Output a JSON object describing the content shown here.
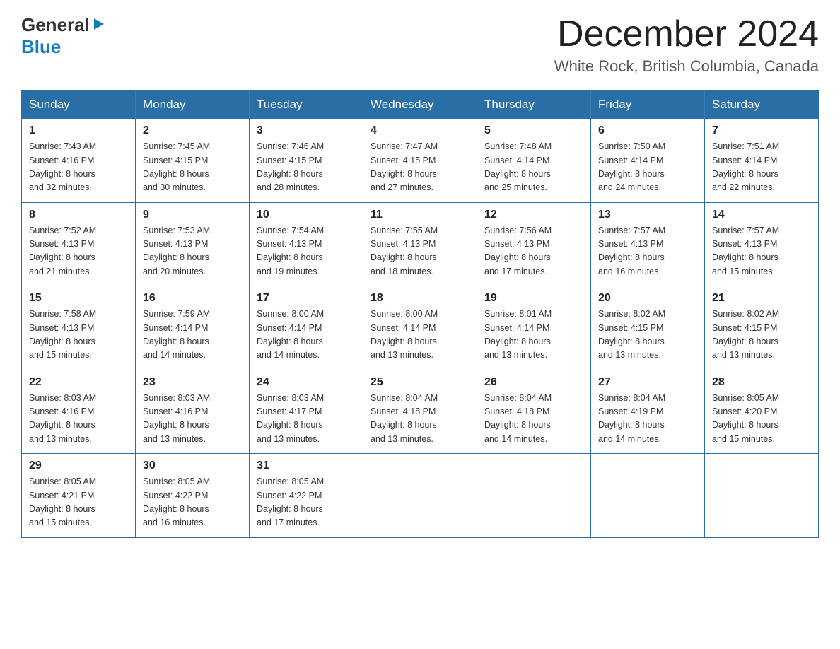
{
  "header": {
    "logo_general": "General",
    "logo_arrow": "▶",
    "logo_blue": "Blue",
    "month_title": "December 2024",
    "location": "White Rock, British Columbia, Canada"
  },
  "days_of_week": [
    "Sunday",
    "Monday",
    "Tuesday",
    "Wednesday",
    "Thursday",
    "Friday",
    "Saturday"
  ],
  "weeks": [
    [
      {
        "day": "1",
        "sunrise": "7:43 AM",
        "sunset": "4:16 PM",
        "daylight": "8 hours and 32 minutes."
      },
      {
        "day": "2",
        "sunrise": "7:45 AM",
        "sunset": "4:15 PM",
        "daylight": "8 hours and 30 minutes."
      },
      {
        "day": "3",
        "sunrise": "7:46 AM",
        "sunset": "4:15 PM",
        "daylight": "8 hours and 28 minutes."
      },
      {
        "day": "4",
        "sunrise": "7:47 AM",
        "sunset": "4:15 PM",
        "daylight": "8 hours and 27 minutes."
      },
      {
        "day": "5",
        "sunrise": "7:48 AM",
        "sunset": "4:14 PM",
        "daylight": "8 hours and 25 minutes."
      },
      {
        "day": "6",
        "sunrise": "7:50 AM",
        "sunset": "4:14 PM",
        "daylight": "8 hours and 24 minutes."
      },
      {
        "day": "7",
        "sunrise": "7:51 AM",
        "sunset": "4:14 PM",
        "daylight": "8 hours and 22 minutes."
      }
    ],
    [
      {
        "day": "8",
        "sunrise": "7:52 AM",
        "sunset": "4:13 PM",
        "daylight": "8 hours and 21 minutes."
      },
      {
        "day": "9",
        "sunrise": "7:53 AM",
        "sunset": "4:13 PM",
        "daylight": "8 hours and 20 minutes."
      },
      {
        "day": "10",
        "sunrise": "7:54 AM",
        "sunset": "4:13 PM",
        "daylight": "8 hours and 19 minutes."
      },
      {
        "day": "11",
        "sunrise": "7:55 AM",
        "sunset": "4:13 PM",
        "daylight": "8 hours and 18 minutes."
      },
      {
        "day": "12",
        "sunrise": "7:56 AM",
        "sunset": "4:13 PM",
        "daylight": "8 hours and 17 minutes."
      },
      {
        "day": "13",
        "sunrise": "7:57 AM",
        "sunset": "4:13 PM",
        "daylight": "8 hours and 16 minutes."
      },
      {
        "day": "14",
        "sunrise": "7:57 AM",
        "sunset": "4:13 PM",
        "daylight": "8 hours and 15 minutes."
      }
    ],
    [
      {
        "day": "15",
        "sunrise": "7:58 AM",
        "sunset": "4:13 PM",
        "daylight": "8 hours and 15 minutes."
      },
      {
        "day": "16",
        "sunrise": "7:59 AM",
        "sunset": "4:14 PM",
        "daylight": "8 hours and 14 minutes."
      },
      {
        "day": "17",
        "sunrise": "8:00 AM",
        "sunset": "4:14 PM",
        "daylight": "8 hours and 14 minutes."
      },
      {
        "day": "18",
        "sunrise": "8:00 AM",
        "sunset": "4:14 PM",
        "daylight": "8 hours and 13 minutes."
      },
      {
        "day": "19",
        "sunrise": "8:01 AM",
        "sunset": "4:14 PM",
        "daylight": "8 hours and 13 minutes."
      },
      {
        "day": "20",
        "sunrise": "8:02 AM",
        "sunset": "4:15 PM",
        "daylight": "8 hours and 13 minutes."
      },
      {
        "day": "21",
        "sunrise": "8:02 AM",
        "sunset": "4:15 PM",
        "daylight": "8 hours and 13 minutes."
      }
    ],
    [
      {
        "day": "22",
        "sunrise": "8:03 AM",
        "sunset": "4:16 PM",
        "daylight": "8 hours and 13 minutes."
      },
      {
        "day": "23",
        "sunrise": "8:03 AM",
        "sunset": "4:16 PM",
        "daylight": "8 hours and 13 minutes."
      },
      {
        "day": "24",
        "sunrise": "8:03 AM",
        "sunset": "4:17 PM",
        "daylight": "8 hours and 13 minutes."
      },
      {
        "day": "25",
        "sunrise": "8:04 AM",
        "sunset": "4:18 PM",
        "daylight": "8 hours and 13 minutes."
      },
      {
        "day": "26",
        "sunrise": "8:04 AM",
        "sunset": "4:18 PM",
        "daylight": "8 hours and 14 minutes."
      },
      {
        "day": "27",
        "sunrise": "8:04 AM",
        "sunset": "4:19 PM",
        "daylight": "8 hours and 14 minutes."
      },
      {
        "day": "28",
        "sunrise": "8:05 AM",
        "sunset": "4:20 PM",
        "daylight": "8 hours and 15 minutes."
      }
    ],
    [
      {
        "day": "29",
        "sunrise": "8:05 AM",
        "sunset": "4:21 PM",
        "daylight": "8 hours and 15 minutes."
      },
      {
        "day": "30",
        "sunrise": "8:05 AM",
        "sunset": "4:22 PM",
        "daylight": "8 hours and 16 minutes."
      },
      {
        "day": "31",
        "sunrise": "8:05 AM",
        "sunset": "4:22 PM",
        "daylight": "8 hours and 17 minutes."
      },
      null,
      null,
      null,
      null
    ]
  ],
  "labels": {
    "sunrise": "Sunrise:",
    "sunset": "Sunset:",
    "daylight": "Daylight:"
  }
}
